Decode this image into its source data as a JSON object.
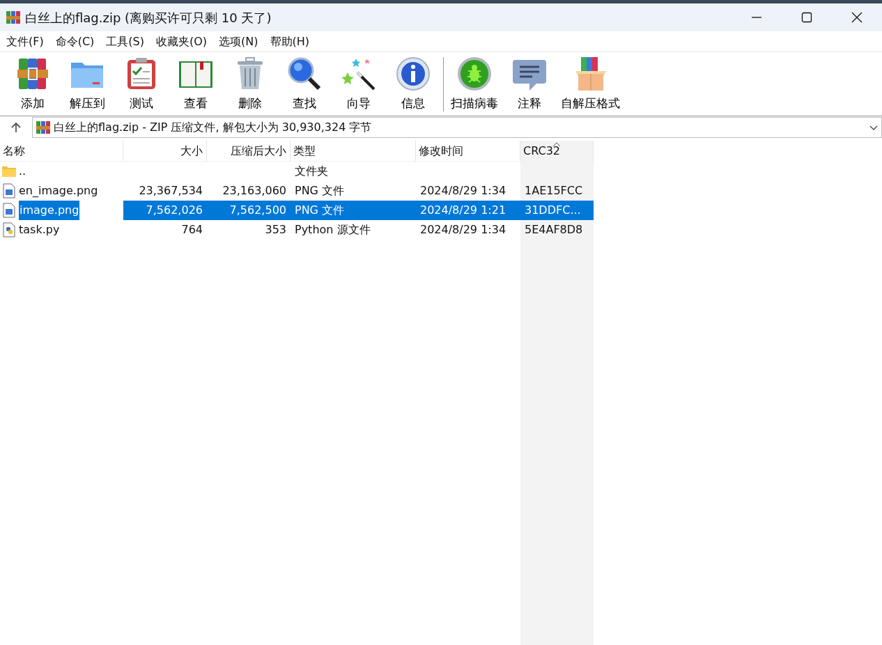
{
  "window": {
    "title": "白丝上的flag.zip (离购买许可只剩 10 天了)"
  },
  "menu": [
    "文件(F)",
    "命令(C)",
    "工具(S)",
    "收藏夹(O)",
    "选项(N)",
    "帮助(H)"
  ],
  "toolbar": [
    {
      "label": "添加"
    },
    {
      "label": "解压到"
    },
    {
      "label": "测试"
    },
    {
      "label": "查看"
    },
    {
      "label": "删除"
    },
    {
      "label": "查找"
    },
    {
      "label": "向导"
    },
    {
      "label": "信息"
    },
    {
      "label": "扫描病毒"
    },
    {
      "label": "注释"
    },
    {
      "label": "自解压格式"
    }
  ],
  "address": "白丝上的flag.zip - ZIP 压缩文件, 解包大小为 30,930,324 字节",
  "table": {
    "columns": [
      {
        "label": "名称",
        "sorted": false
      },
      {
        "label": "大小",
        "sorted": false
      },
      {
        "label": "压缩后大小",
        "sorted": false
      },
      {
        "label": "类型",
        "sorted": false
      },
      {
        "label": "修改时间",
        "sorted": false
      },
      {
        "label": "CRC32",
        "sorted": true
      }
    ],
    "rows": [
      {
        "kind": "folder",
        "selected": false,
        "cells": [
          "..",
          "",
          "",
          "文件夹",
          "",
          ""
        ]
      },
      {
        "kind": "image",
        "selected": false,
        "cells": [
          "en_image.png",
          "23,367,534",
          "23,163,060",
          "PNG 文件",
          "2024/8/29 1:34",
          "1AE15FCC"
        ]
      },
      {
        "kind": "image",
        "selected": true,
        "cells": [
          "image.png",
          "7,562,026",
          "7,562,500",
          "PNG 文件",
          "2024/8/29 1:21",
          "31DDFC..."
        ]
      },
      {
        "kind": "python",
        "selected": false,
        "cells": [
          "task.py",
          "764",
          "353",
          "Python 源文件",
          "2024/8/29 1:34",
          "5E4AF8D8"
        ]
      }
    ]
  }
}
